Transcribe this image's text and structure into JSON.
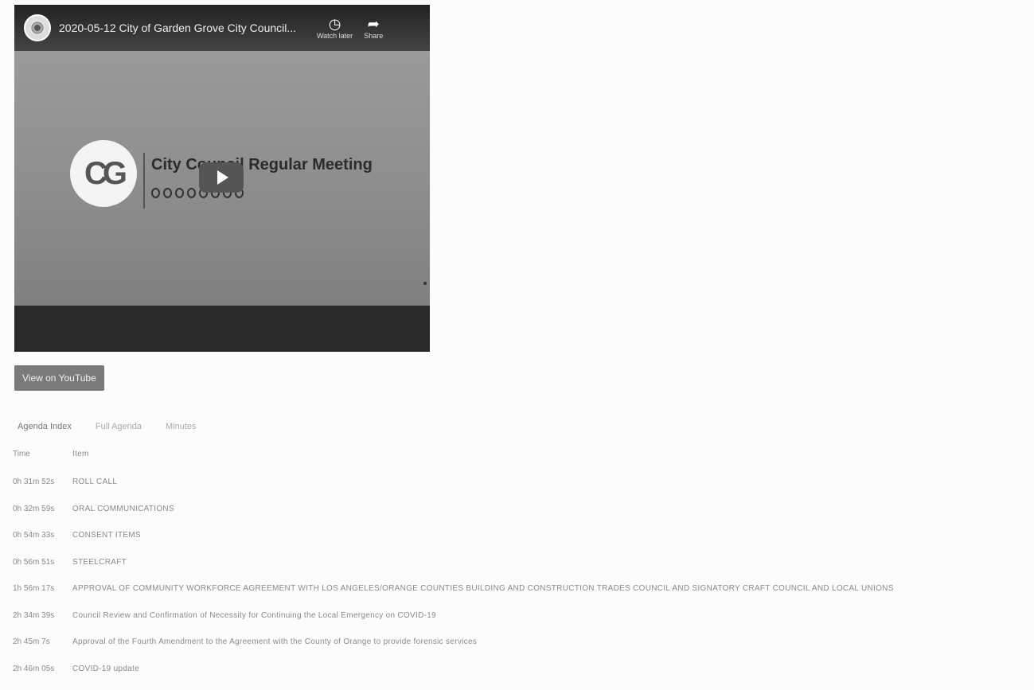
{
  "video": {
    "title": "2020-05-12 City of Garden Grove City Council...",
    "watch_later_label": "Watch later",
    "share_label": "Share",
    "meeting_title": "City Council Regular Meeting"
  },
  "icons": {
    "watch_later": "clock-icon",
    "share": "share-arrow-icon",
    "play": "play-icon"
  },
  "view_on_youtube_label": "View on YouTube",
  "tabs": [
    {
      "label": "Agenda Index",
      "active": true
    },
    {
      "label": "Full Agenda",
      "active": false
    },
    {
      "label": "Minutes",
      "active": false
    }
  ],
  "agenda": {
    "headers": {
      "time": "Time",
      "item": "Item"
    },
    "rows": [
      {
        "time": "0h 31m 52s",
        "item": "ROLL CALL"
      },
      {
        "time": "0h 32m 59s",
        "item": "ORAL COMMUNICATIONS"
      },
      {
        "time": "0h 54m 33s",
        "item": "CONSENT ITEMS"
      },
      {
        "time": "0h 56m 51s",
        "item": "STEELCRAFT"
      },
      {
        "time": "1h 56m 17s",
        "item": "APPROVAL OF COMMUNITY WORKFORCE AGREEMENT WITH LOS ANGELES/ORANGE COUNTIES BUILDING AND CONSTRUCTION TRADES COUNCIL AND SIGNATORY CRAFT COUNCIL AND LOCAL UNIONS"
      },
      {
        "time": "2h 34m 39s",
        "item": "Council Review and Confirmation of Necessity for Continuing the Local Emergency on COVID-19"
      },
      {
        "time": "2h 45m 7s",
        "item": "Approval of the Fourth Amendment to the Agreement with the County of Orange to provide forensic services"
      },
      {
        "time": "2h 46m 05s",
        "item": "COVID-19 update"
      }
    ]
  }
}
